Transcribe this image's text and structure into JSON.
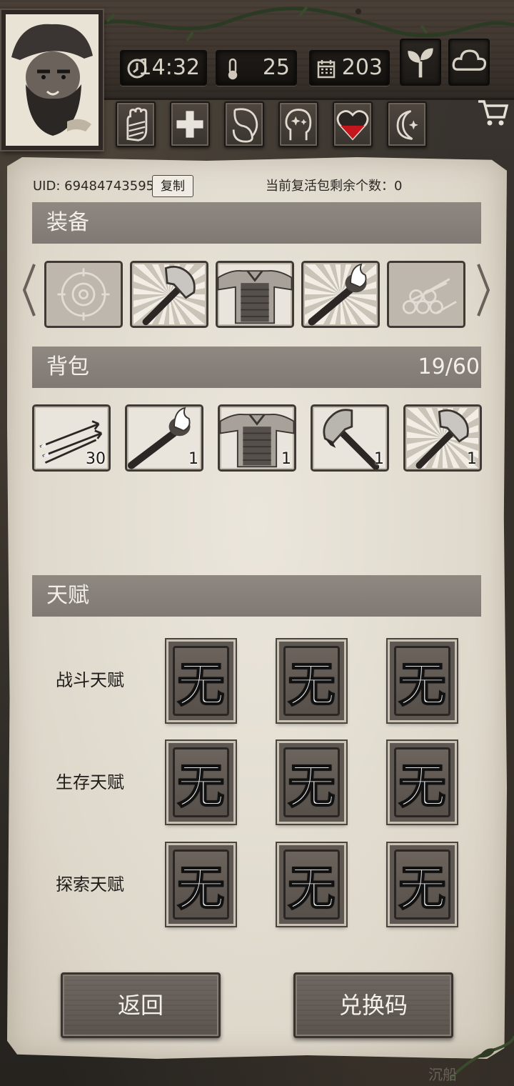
{
  "hud": {
    "time": "14:32",
    "temperature": "25",
    "day": "203"
  },
  "account": {
    "uid_text": "UID: 694847435956",
    "copy_label": "复制",
    "revive_text": "当前复活包剩余个数：0"
  },
  "equipment": {
    "title": "装备",
    "slots": [
      {
        "item": "target-slot-empty",
        "state": "disabled"
      },
      {
        "item": "axe",
        "state": "active"
      },
      {
        "item": "chest-armor",
        "state": "active"
      },
      {
        "item": "torch",
        "state": "active"
      },
      {
        "item": "logs-slot-empty",
        "state": "disabled"
      }
    ]
  },
  "backpack": {
    "title": "背包",
    "capacity": "19/60",
    "items": [
      {
        "item": "arrows",
        "count": "30"
      },
      {
        "item": "torch",
        "count": "1"
      },
      {
        "item": "chest-armor",
        "count": "1"
      },
      {
        "item": "bloody-axe",
        "count": "1"
      },
      {
        "item": "axe",
        "count": "1"
      }
    ]
  },
  "talents": {
    "title": "天赋",
    "rows": [
      {
        "label": "战斗天赋",
        "cards": [
          "无",
          "无",
          "无"
        ]
      },
      {
        "label": "生存天赋",
        "cards": [
          "无",
          "无",
          "无"
        ]
      },
      {
        "label": "探索天赋",
        "cards": [
          "无",
          "无",
          "无"
        ]
      }
    ]
  },
  "buttons": {
    "back": "返回",
    "redeem": "兑换码"
  },
  "watermark": "沉船",
  "colors": {
    "section_bar": "#878079",
    "paper": "#e4dfd4",
    "heart_red": "#c4161c"
  }
}
